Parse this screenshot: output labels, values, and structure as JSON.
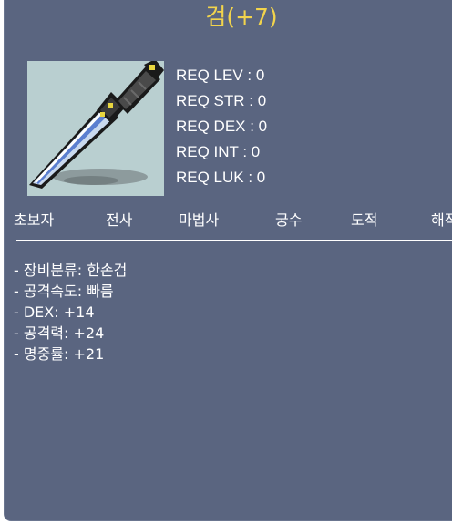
{
  "item": {
    "name": "검(+7)",
    "icon": "dagger-icon"
  },
  "requirements": [
    "REQ LEV : 0",
    "REQ STR : 0",
    "REQ DEX : 0",
    "REQ INT : 0",
    "REQ LUK : 0"
  ],
  "jobs": [
    "초보자",
    "전사",
    "마법사",
    "궁수",
    "도적",
    "해적"
  ],
  "stats": [
    "- 장비분류: 한손검",
    "- 공격속도: 빠름",
    "- DEX: +14",
    "- 공격력: +24",
    "- 명중률: +21"
  ],
  "colors": {
    "panel": "#5a6580",
    "title": "#f2d44c",
    "icon_bg": "#b9cfd0",
    "text": "#ffffff"
  }
}
